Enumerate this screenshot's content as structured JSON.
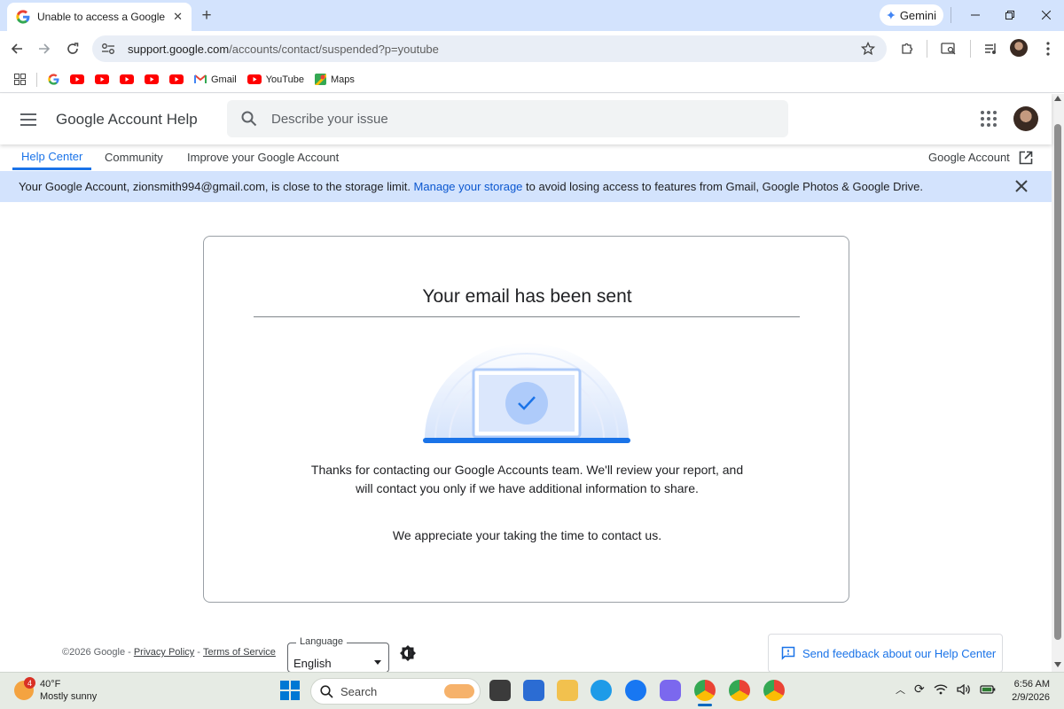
{
  "browser": {
    "tab_title": "Unable to access a Google prod",
    "gemini_label": "Gemini",
    "url_host": "support.google.com",
    "url_path": "/accounts/contact/suspended?p=youtube",
    "bookmarks": {
      "gmail": "Gmail",
      "youtube": "YouTube",
      "maps": "Maps"
    }
  },
  "header": {
    "site_title": "Google Account Help",
    "search_placeholder": "Describe your issue"
  },
  "nav": {
    "help_center": "Help Center",
    "community": "Community",
    "improve": "Improve your Google Account",
    "google_account": "Google Account"
  },
  "banner": {
    "text_before": "Your Google Account, zionsmith994@gmail.com, is close to the storage limit. ",
    "link": "Manage your storage",
    "text_after": " to avoid losing access to features from Gmail, Google Photos & Google Drive."
  },
  "card": {
    "title": "Your email has been sent",
    "message1": "Thanks for contacting our Google Accounts team. We'll review your report, and will contact you only if we have additional information to share.",
    "message2": "We appreciate your taking the time to contact us."
  },
  "footer": {
    "copyright": "©2026 Google -",
    "privacy": "Privacy Policy",
    "dash": "-",
    "terms": "Terms of Service",
    "language_label": "Language",
    "language_value": "English",
    "feedback": "Send feedback about our Help Center"
  },
  "taskbar": {
    "weather_temp": "40°F",
    "weather_desc": "Mostly sunny",
    "weather_badge": "4",
    "search_label": "Search",
    "time": "6:56 AM",
    "date": "2/9/2026"
  },
  "colors": {
    "accent": "#1a73e8",
    "banner_bg": "#d3e3fd",
    "tabstrip_bg": "#d3e3fd"
  }
}
